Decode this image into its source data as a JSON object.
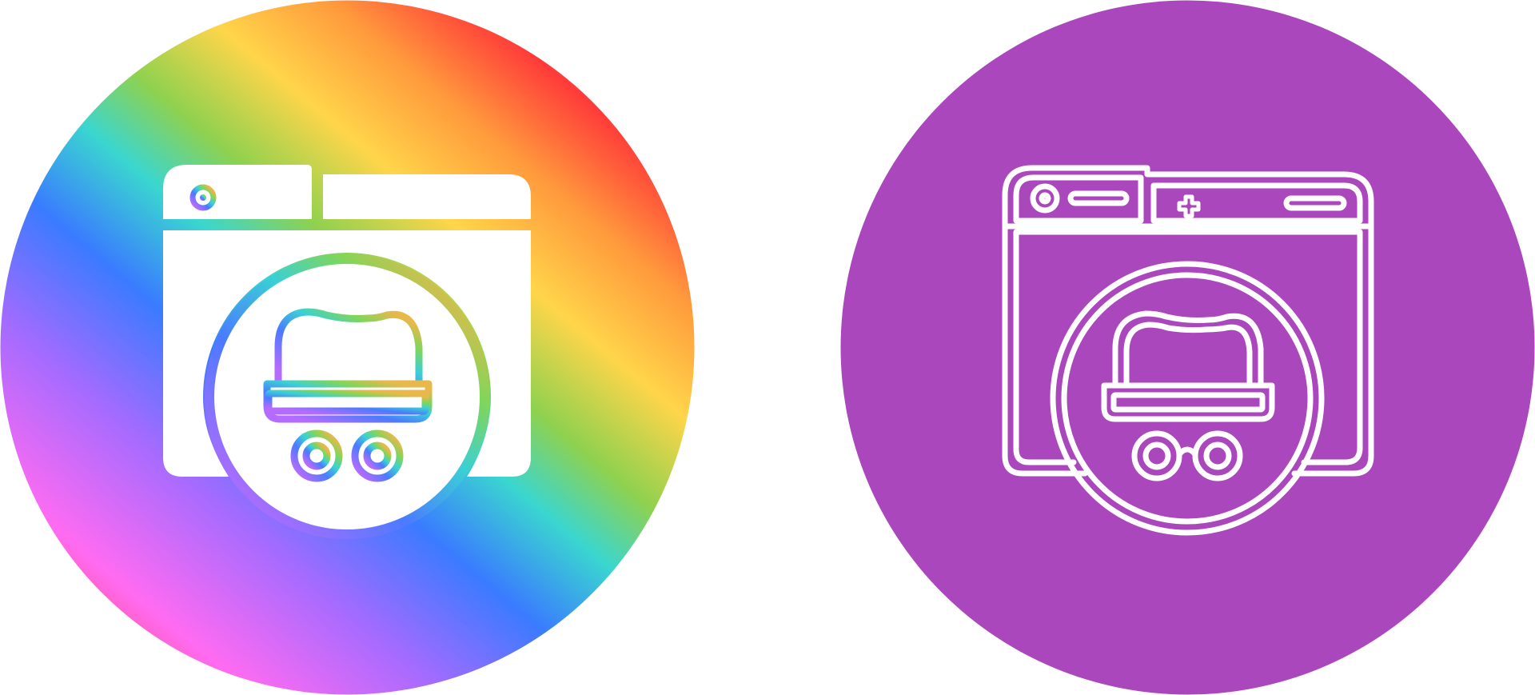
{
  "icons": [
    {
      "name": "incognito-browser-icon",
      "style": "glyph-gradient",
      "background": "rainbow-gradient-circle",
      "gradient_colors": [
        "#ff3a3a",
        "#ff9a3c",
        "#ffd54a",
        "#8fd14f",
        "#3ad6d0",
        "#3a7bff",
        "#a26bff",
        "#ff6bf2",
        "#ff3a3a",
        "#ffffff"
      ]
    },
    {
      "name": "incognito-browser-icon",
      "style": "outline",
      "background_color": "#ab47bc",
      "stroke_color": "#ffffff"
    }
  ]
}
